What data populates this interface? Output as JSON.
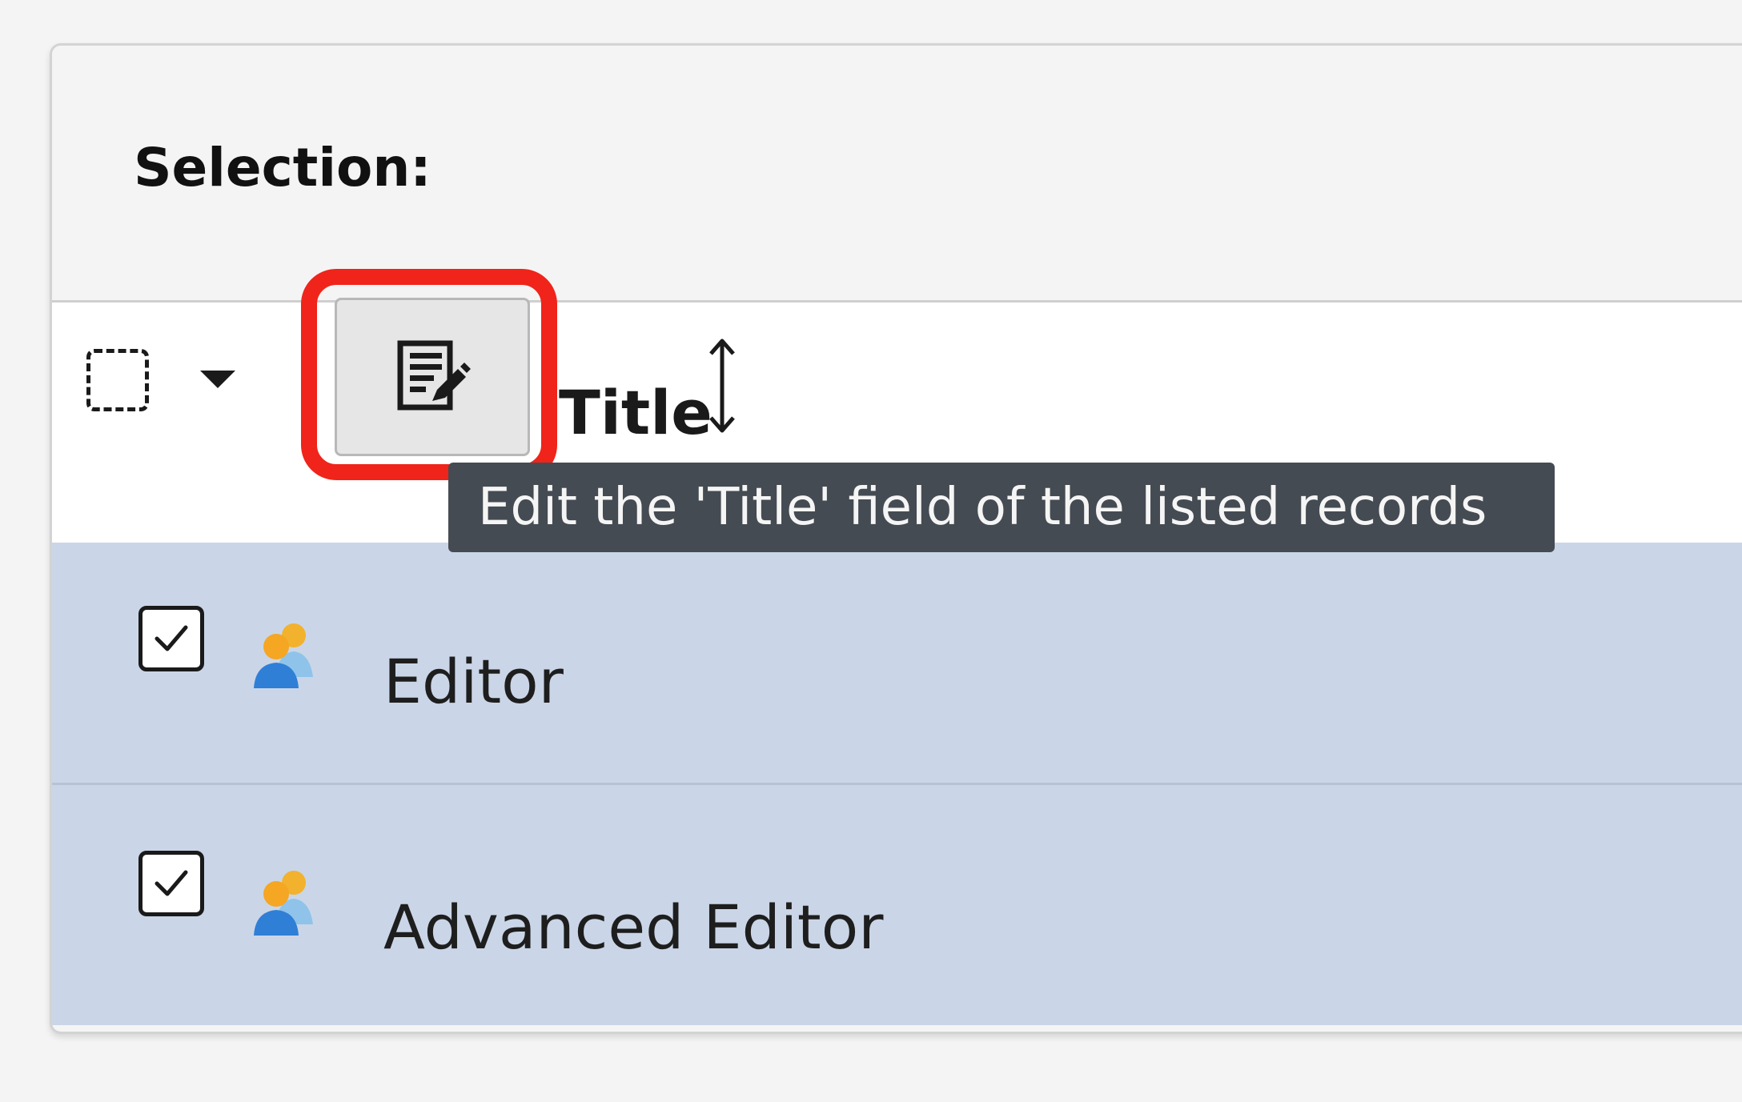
{
  "selection": {
    "title": "Selection:"
  },
  "column_header": {
    "edit_button_icon": "edit-document-icon",
    "column_title": "Title",
    "sort_icon": "sort-arrows-icon"
  },
  "tooltip": {
    "text": "Edit the 'Title' field of the listed records"
  },
  "rows": [
    {
      "label": "Editor",
      "checked": true,
      "icon": "user-group-icon"
    },
    {
      "label": "Advanced Editor",
      "checked": true,
      "icon": "user-group-icon"
    }
  ],
  "colors": {
    "highlight": "#f0241a",
    "selected_row": "#cad6e7",
    "tooltip_bg": "#454b52"
  }
}
